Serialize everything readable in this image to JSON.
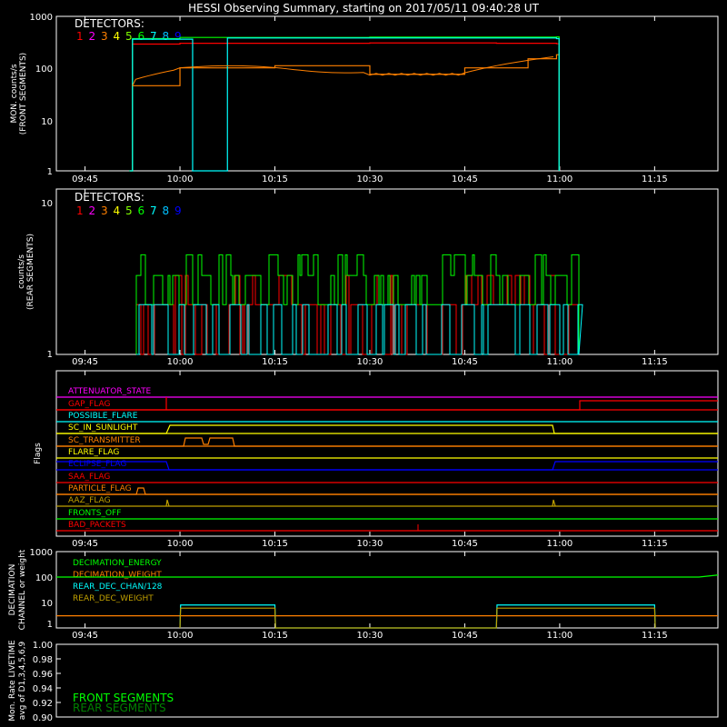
{
  "title": "HESSI Observing Summary, starting on 2017/05/11 09:40:28 UT",
  "x_ticks": [
    "09:45",
    "10:00",
    "10:15",
    "10:30",
    "10:45",
    "11:00",
    "11:15"
  ],
  "detector_colors": [
    "#ff0000",
    "#ff00ff",
    "#ff8000",
    "#ffff00",
    "#80ff00",
    "#00ff00",
    "#00ffff",
    "#00c0ff",
    "#0000ff"
  ],
  "panel1": {
    "ylabel_line1": "MON. counts/s",
    "ylabel_line2": "(FRONT SEGMENTS)",
    "y_ticks": [
      "1000",
      "100",
      "10",
      "1"
    ],
    "legend_title": "DETECTORS:",
    "legend_numbers": [
      "1",
      "2",
      "3",
      "4",
      "5",
      "6",
      "7",
      "8",
      "9"
    ]
  },
  "panel2": {
    "ylabel_line1": "counts/s",
    "ylabel_line2": "(REAR SEGMENTS)",
    "y_ticks": [
      "10",
      "1"
    ],
    "legend_title": "DETECTORS:",
    "legend_numbers": [
      "1",
      "2",
      "3",
      "4",
      "5",
      "6",
      "7",
      "8",
      "9"
    ]
  },
  "panel3": {
    "ylabel": "Flags",
    "flags": [
      {
        "label": "ATTENUATOR_STATE",
        "color": "#ff00ff"
      },
      {
        "label": "GAP_FLAG",
        "color": "#ff0000"
      },
      {
        "label": "POSSIBLE_FLARE",
        "color": "#00ffff"
      },
      {
        "label": "SC_IN_SUNLIGHT",
        "color": "#ffff00"
      },
      {
        "label": "SC_TRANSMITTER",
        "color": "#ff8000"
      },
      {
        "label": "FLARE_FLAG",
        "color": "#ffff00"
      },
      {
        "label": "ECLIPSE_FLAG",
        "color": "#0000ff"
      },
      {
        "label": "SAA_FLAG",
        "color": "#ff0000"
      },
      {
        "label": "PARTICLE_FLAG",
        "color": "#ff8000"
      },
      {
        "label": "AAZ_FLAG",
        "color": "#c0a000"
      },
      {
        "label": "FRONTS_OFF",
        "color": "#00ff00"
      },
      {
        "label": "BAD_PACKETS",
        "color": "#ff0000"
      }
    ]
  },
  "panel4": {
    "ylabel_line1": "DECIMATION",
    "ylabel_line2": "CHANNEL or weight",
    "y_ticks": [
      "1000",
      "100",
      "10",
      "1"
    ],
    "legend": [
      {
        "label": "DECIMATION_ENERGY",
        "color": "#00ff00"
      },
      {
        "label": "DECIMATION_WEIGHT",
        "color": "#ff8000"
      },
      {
        "label": "REAR_DEC_CHAN/128",
        "color": "#00ffff"
      },
      {
        "label": "REAR_DEC_WEIGHT",
        "color": "#c0a000"
      }
    ]
  },
  "panel5": {
    "ylabel_line1": "Mon. Rate LIVETIME",
    "ylabel_line2": "avg of D1,3,4,5,6,9",
    "y_ticks": [
      "1.00",
      "0.98",
      "0.96",
      "0.94",
      "0.92",
      "0.90"
    ],
    "legend": [
      {
        "label": "FRONT SEGMENTS",
        "color": "#00ff00"
      },
      {
        "label": "REAR SEGMENTS",
        "color": "#008000"
      }
    ]
  },
  "chart_data": [
    {
      "type": "line",
      "title": "HESSI Observing Summary, starting on 2017/05/11 09:40:28 UT",
      "ylabel": "MON. counts/s (FRONT SEGMENTS)",
      "yscale": "log",
      "ylim": [
        1,
        1000
      ],
      "xlim": [
        "09:40:28",
        "11:25"
      ],
      "series": [
        {
          "name": "1",
          "x": [
            "09:52",
            "09:52.5",
            "10:00",
            "10:30",
            "10:50",
            "10:59.5",
            "10:59.9"
          ],
          "values": [
            1,
            290,
            300,
            305,
            300,
            295,
            1
          ]
        },
        {
          "name": "3",
          "x": [
            "09:52",
            "09:52.5",
            "10:00",
            "10:15",
            "10:30",
            "10:45",
            "10:55",
            "10:59.5",
            "10:59.9"
          ],
          "values": [
            1,
            45,
            100,
            110,
            75,
            100,
            150,
            180,
            1
          ]
        },
        {
          "name": "6",
          "x": [
            "09:52",
            "09:52.5",
            "10:00",
            "10:30",
            "10:59.5",
            "10:59.9"
          ],
          "values": [
            1,
            370,
            390,
            395,
            400,
            1
          ]
        },
        {
          "name": "7",
          "x": [
            "09:52",
            "09:52.5",
            "10:01.5",
            "10:02",
            "10:07",
            "10:07.5",
            "10:59.5",
            "10:59.9"
          ],
          "values": [
            1,
            360,
            360,
            1,
            1,
            380,
            370,
            1
          ]
        }
      ]
    },
    {
      "type": "line",
      "ylabel": "counts/s (REAR SEGMENTS)",
      "yscale": "log",
      "ylim": [
        1,
        10
      ],
      "note_values": "piecewise step counts of 1-5 counts/s",
      "series": [
        {
          "name": "1",
          "values": [
            1,
            2,
            3,
            4,
            5
          ]
        },
        {
          "name": "6",
          "values": [
            1,
            2,
            3,
            4
          ]
        },
        {
          "name": "7",
          "values": [
            1,
            2
          ]
        }
      ]
    },
    {
      "type": "line",
      "ylabel": "DECIMATION CHANNEL or weight",
      "yscale": "log",
      "ylim": [
        1,
        1000
      ],
      "series": [
        {
          "name": "DECIMATION_ENERGY",
          "x": [
            "09:40:28",
            "11:22",
            "11:25"
          ],
          "values": [
            100,
            100,
            120
          ]
        },
        {
          "name": "DECIMATION_WEIGHT",
          "x": [
            "09:40:28",
            "11:25"
          ],
          "values": [
            3,
            3
          ]
        },
        {
          "name": "REAR_DEC_CHAN/128",
          "x": [
            "10:00",
            "10:00.1",
            "10:15",
            "10:15.1",
            "10:50",
            "10:50.1",
            "11:15",
            "11:15.1"
          ],
          "values": [
            1,
            8,
            8,
            1,
            1,
            8,
            8,
            1
          ]
        },
        {
          "name": "REAR_DEC_WEIGHT",
          "x": [
            "10:00",
            "10:00.1",
            "10:15",
            "10:15.1",
            "10:50",
            "10:50.1",
            "11:15",
            "11:15.1"
          ],
          "values": [
            1,
            6,
            6,
            1,
            1,
            6,
            6,
            1
          ]
        }
      ]
    },
    {
      "type": "line",
      "ylabel": "Mon. Rate LIVETIME avg of D1,3,4,5,6,9",
      "ylim": [
        0.9,
        1.0
      ],
      "series": []
    }
  ]
}
